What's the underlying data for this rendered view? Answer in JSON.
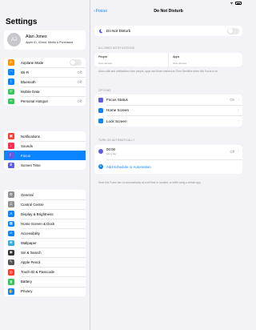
{
  "status_bar": {
    "time": "09:00"
  },
  "settings": {
    "title": "Settings",
    "profile": {
      "initials": "AJ",
      "name": "Alan Jones",
      "subtitle": "Apple ID, iCloud, Media & Purchases"
    },
    "group1": [
      {
        "label": "Airplane Mode",
        "icon": "airplane-icon",
        "color": "#ff9500",
        "glyph": "✈",
        "value": "",
        "toggle": true
      },
      {
        "label": "Wi-Fi",
        "icon": "wifi-icon",
        "color": "#0a84ff",
        "glyph": "◠",
        "value": "Off"
      },
      {
        "label": "Bluetooth",
        "icon": "bluetooth-icon",
        "color": "#0a84ff",
        "glyph": "ᛒ",
        "value": "Off"
      },
      {
        "label": "Mobile Data",
        "icon": "mobile-data-icon",
        "color": "#34c759",
        "glyph": "⊙",
        "value": ""
      },
      {
        "label": "Personal Hotspot",
        "icon": "hotspot-icon",
        "color": "#34c759",
        "glyph": "∞",
        "value": "Off"
      }
    ],
    "group2": [
      {
        "label": "Notifications",
        "icon": "notifications-icon",
        "color": "#ff3b30",
        "glyph": "▣"
      },
      {
        "label": "Sounds",
        "icon": "sounds-icon",
        "color": "#ff2d55",
        "glyph": "♪"
      },
      {
        "label": "Focus",
        "icon": "moon-icon",
        "color": "#5e5ce6",
        "glyph": "☾",
        "selected": true
      },
      {
        "label": "Screen Time",
        "icon": "hourglass-icon",
        "color": "#5e5ce6",
        "glyph": "⧗"
      }
    ],
    "group3": [
      {
        "label": "General",
        "icon": "gear-icon",
        "color": "#8e8e93",
        "glyph": "⚙"
      },
      {
        "label": "Control Centre",
        "icon": "control-centre-icon",
        "color": "#8e8e93",
        "glyph": "☰"
      },
      {
        "label": "Display & Brightness",
        "icon": "display-icon",
        "color": "#0a84ff",
        "glyph": "A"
      },
      {
        "label": "Home Screen & Dock",
        "icon": "home-screen-icon",
        "color": "#0a84ff",
        "glyph": "▦"
      },
      {
        "label": "Accessibility",
        "icon": "accessibility-icon",
        "color": "#0a84ff",
        "glyph": "☺"
      },
      {
        "label": "Wallpaper",
        "icon": "wallpaper-icon",
        "color": "#32ade6",
        "glyph": "❀"
      },
      {
        "label": "Siri & Search",
        "icon": "siri-icon",
        "color": "#333333",
        "glyph": "◉"
      },
      {
        "label": "Apple Pencil",
        "icon": "pencil-icon",
        "color": "#555555",
        "glyph": "✎"
      },
      {
        "label": "Touch ID & Passcode",
        "icon": "fingerprint-icon",
        "color": "#ff3b30",
        "glyph": "◎"
      },
      {
        "label": "Battery",
        "icon": "battery-icon",
        "color": "#34c759",
        "glyph": "▮"
      },
      {
        "label": "Privacy",
        "icon": "hand-icon",
        "color": "#0a84ff",
        "glyph": "✋"
      }
    ]
  },
  "detail": {
    "back_label": "Focus",
    "title": "Do Not Disturb",
    "dnd_label": "Do Not Disturb",
    "allowed_header": "ALLOWED NOTIFICATIONS",
    "people_label": "People",
    "people_sub": "None allowed",
    "apps_label": "Apps",
    "apps_sub": "None allowed",
    "allowed_footnote": "Allow calls and notifications from people, apps and those marked as Time Sensitive when this Focus is on.",
    "options_header": "OPTIONS",
    "options": [
      {
        "label": "Focus Status",
        "value": "On",
        "icon": "focus-status-icon"
      },
      {
        "label": "Home Screen",
        "value": "",
        "icon": "home-screen-option-icon"
      },
      {
        "label": "Lock Screen",
        "value": "",
        "icon": "lock-screen-icon"
      }
    ],
    "auto_header": "TURN ON AUTOMATICALLY",
    "schedule_time": "00:00",
    "schedule_sub": "Every day",
    "schedule_value": "Off",
    "add_label": "Add Schedule or Automation",
    "auto_footnote": "Have this Focus turn on automatically at a set time or location, or while using a certain app."
  }
}
